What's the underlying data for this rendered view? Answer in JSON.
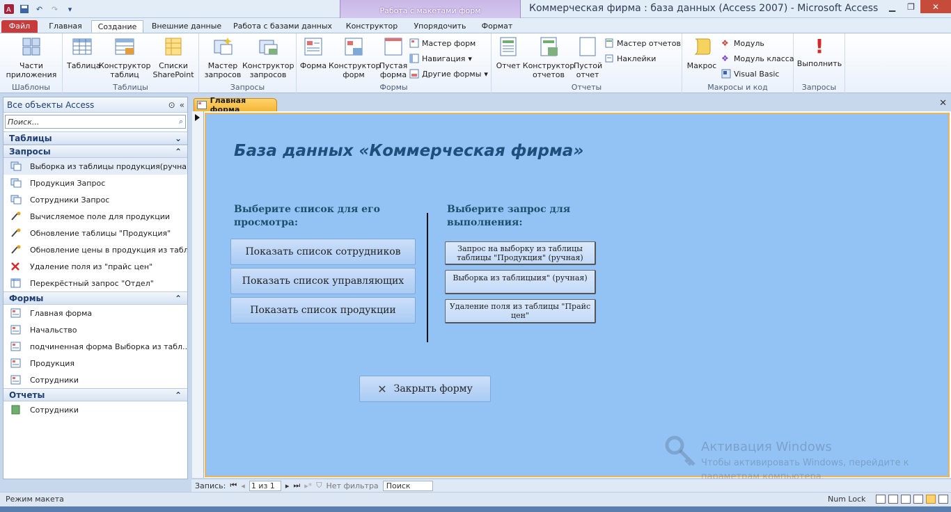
{
  "window": {
    "title": "Коммерческая фирма : база данных (Access 2007)  -  Microsoft Access"
  },
  "context_tab_group": "Работа с макетами форм",
  "ribbon_tabs": [
    "Файл",
    "Главная",
    "Создание",
    "Внешние данные",
    "Работа с базами данных",
    "Конструктор",
    "Упорядочить",
    "Формат"
  ],
  "ribbon": {
    "templates": {
      "label": "Шаблоны",
      "parts": "Части\nприложения"
    },
    "tables": {
      "label": "Таблицы",
      "table": "Таблица",
      "designer": "Конструктор\nтаблиц",
      "sharepoint": "Списки\nSharePoint"
    },
    "queries": {
      "label": "Запросы",
      "wizard": "Мастер\nзапросов",
      "designer": "Конструктор\nзапросов"
    },
    "forms": {
      "label": "Формы",
      "form": "Форма",
      "designer": "Конструктор\nформ",
      "blank": "Пустая\nформа",
      "wizard": "Мастер форм",
      "navigation": "Навигация",
      "other": "Другие формы"
    },
    "reports": {
      "label": "Отчеты",
      "report": "Отчет",
      "designer": "Конструктор\nотчетов",
      "blank": "Пустой\nотчет",
      "wizard": "Мастер отчетов",
      "labels": "Наклейки"
    },
    "macros": {
      "label": "Макросы и код",
      "macro": "Макрос",
      "module": "Модуль",
      "class_module": "Модуль класса",
      "vb": "Visual Basic"
    },
    "run": {
      "label": "Запросы",
      "execute": "Выполнить"
    }
  },
  "nav": {
    "header": "Все объекты Access",
    "search_placeholder": "Поиск...",
    "sections": {
      "tables": "Таблицы",
      "queries": "Запросы",
      "forms": "Формы",
      "reports": "Отчеты"
    },
    "queries": [
      "Выборка из таблицы продукция(ручная)",
      "Продукция Запрос",
      "Сотрудники Запрос",
      "Вычисляемое поле для продукции",
      "Обновление таблицы \"Продукция\"",
      "Обновление цены в продукция из табл...",
      "Удаление поля из \"прайс цен\"",
      "Перекрёстный запрос \"Отдел\""
    ],
    "forms": [
      "Главная форма",
      "Начальство",
      "подчиненная форма Выборка из табл...",
      "Продукция",
      "Сотрудники"
    ],
    "reports": [
      "Сотрудники"
    ]
  },
  "doc_tab": "Главная форма",
  "form": {
    "title": "База данных «Коммерческая фирма»",
    "left_caption": "Выберите список для его\nпросмотра:",
    "right_caption": "Выберите запрос для\nвыполнения:",
    "btn_employees": "Показать список сотрудников",
    "btn_managers": "Показать список управляющих",
    "btn_products": "Показать список продукции",
    "btn_q1": "Запрос на выборку из таблицы\nтаблицы \"Продукция\" (ручная)",
    "btn_q2": "Выборка из таблицыия\" (ручная)",
    "btn_q3": "Удаление поля из таблицы \"Прайс\nцен\"",
    "btn_close": "Закрыть форму"
  },
  "record_bar": {
    "label": "Запись:",
    "position": "1 из 1",
    "filter": "Нет фильтра",
    "search": "Поиск"
  },
  "status": {
    "mode": "Режим макета",
    "numlock": "Num Lock"
  },
  "watermark": {
    "title": "Активация Windows",
    "line1": "Чтобы активировать Windows, перейдите к",
    "line2": "параметрам компьютера."
  }
}
